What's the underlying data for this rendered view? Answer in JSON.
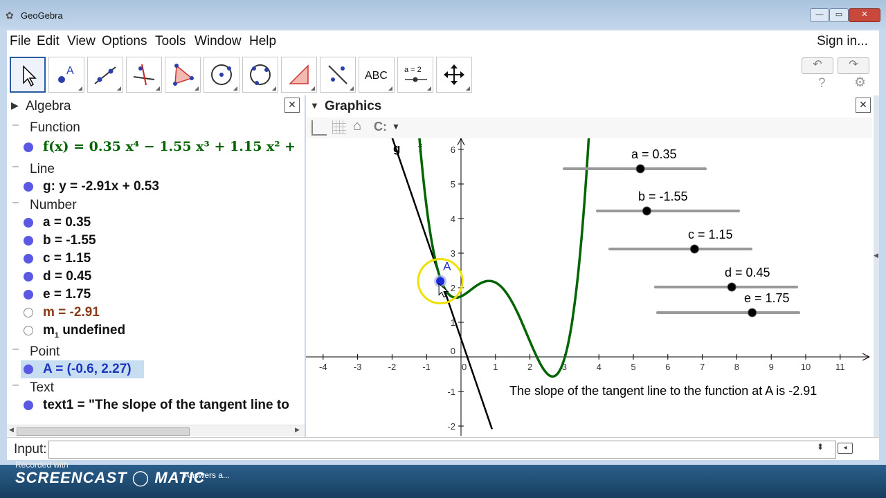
{
  "window": {
    "title": "GeoGebra"
  },
  "menu": {
    "items": [
      "File",
      "Edit",
      "View",
      "Options",
      "Tools",
      "Window",
      "Help"
    ],
    "sign_in": "Sign in..."
  },
  "toolbar": {
    "tools": [
      "move-tool",
      "point-tool",
      "line-tool",
      "perpendicular-line-tool",
      "polygon-tool",
      "circle-tool",
      "conic-tool",
      "angle-tool",
      "reflect-tool",
      "text-tool",
      "slider-tool",
      "move-graphics-tool"
    ],
    "text_tool_label": "ABC",
    "slider_tool_label": "a = 2"
  },
  "algebra": {
    "title": "Algebra",
    "categories": {
      "function": "Function",
      "line": "Line",
      "number": "Number",
      "point": "Point",
      "text": "Text"
    },
    "function_row": "f(x) = 0.35 x⁴ − 1.55 x³ + 1.15 x² +",
    "line_row": "g: y = -2.91x + 0.53",
    "number_rows": [
      "a = 0.35",
      "b = -1.55",
      "c = 1.15",
      "d = 0.45",
      "e = 1.75",
      "m = -2.91"
    ],
    "m1_row": {
      "name": "m",
      "sub": "1",
      "rest": " undefined"
    },
    "point_row": "A = (-0.6, 2.27)",
    "text_row": "text1 = \"The slope of the tangent line to"
  },
  "graphics": {
    "title": "Graphics",
    "curve_labels": {
      "g": "g",
      "f": "f"
    },
    "point_label": "A",
    "sliders": [
      {
        "label": "a = 0.35",
        "value": 0.35
      },
      {
        "label": "b = -1.55",
        "value": -1.55
      },
      {
        "label": "c = 1.15",
        "value": 1.15
      },
      {
        "label": "d = 0.45",
        "value": 0.45
      },
      {
        "label": "e = 1.75",
        "value": 1.75
      }
    ],
    "x_ticks": [
      "-4",
      "-3",
      "-2",
      "-1",
      "0",
      "1",
      "2",
      "3",
      "4",
      "5",
      "6",
      "7",
      "8",
      "9",
      "10",
      "11"
    ],
    "y_ticks": [
      "6",
      "5",
      "4",
      "3",
      "2",
      "1",
      "0",
      "-1",
      "-2"
    ],
    "annotation": "The slope of the tangent line to the function at A is -2.91",
    "function": {
      "a": 0.35,
      "b": -1.55,
      "c": 1.15,
      "d": 0.45,
      "e": 1.75
    },
    "line": {
      "m": -2.91,
      "b": 0.53
    },
    "point": {
      "x": -0.6,
      "y": 2.27
    },
    "colors": {
      "function": "#006400",
      "line": "#000000",
      "point": "#1a2bd8",
      "highlight": "#f0e000"
    }
  },
  "input_bar": {
    "label": "Input:"
  },
  "overlay": {
    "recorded": "Recorded with",
    "brand": "SCREENCAST ◯ MATIC",
    "answers": "Answers a..."
  }
}
